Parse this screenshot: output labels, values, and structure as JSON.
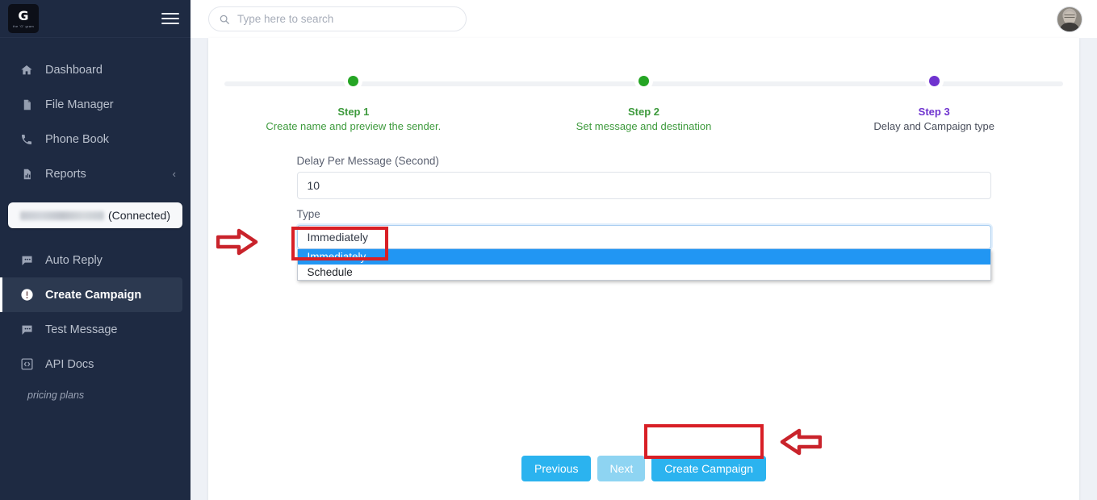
{
  "sidebar": {
    "logo": {
      "letter": "G",
      "subtitle": "the 'G' gram"
    },
    "menu_icon": "hamburger-icon",
    "items": [
      {
        "label": "Dashboard",
        "icon": "home-icon",
        "active": false
      },
      {
        "label": "File Manager",
        "icon": "document-icon",
        "active": false
      },
      {
        "label": "Phone Book",
        "icon": "phone-icon",
        "active": false
      },
      {
        "label": "Reports",
        "icon": "report-chart-icon",
        "active": false,
        "chevron": "‹"
      }
    ],
    "connected_account": {
      "name_redacted": true,
      "status": "(Connected)"
    },
    "items2": [
      {
        "label": "Auto Reply",
        "icon": "chat-bubble-icon",
        "active": false
      },
      {
        "label": "Create Campaign",
        "icon": "alert-circle-icon",
        "active": true
      },
      {
        "label": "Test Message",
        "icon": "chat-bubble-icon",
        "active": false
      },
      {
        "label": "API Docs",
        "icon": "code-brackets-icon",
        "active": false
      }
    ],
    "pricing_link": "pricing plans"
  },
  "topbar": {
    "search": {
      "placeholder": "Type here to search",
      "value": "",
      "icon": "search-icon"
    },
    "avatar": "user-avatar"
  },
  "stepper": {
    "steps": [
      {
        "title": "Step 1",
        "desc": "Create name and preview the sender.",
        "state": "done",
        "color": "#25a524"
      },
      {
        "title": "Step 2",
        "desc": "Set message and destination",
        "state": "done",
        "color": "#25a524"
      },
      {
        "title": "Step 3",
        "desc": "Delay and Campaign type",
        "state": "current",
        "color": "#6f33cf"
      }
    ]
  },
  "form": {
    "delay": {
      "label": "Delay Per Message (Second)",
      "value": "10"
    },
    "type": {
      "label": "Type",
      "selected": "Immediately",
      "options": [
        {
          "label": "Immediately",
          "selected": true
        },
        {
          "label": "Schedule",
          "selected": false
        }
      ]
    }
  },
  "buttons": {
    "previous": "Previous",
    "next": "Next",
    "create": "Create Campaign"
  },
  "annotations": {
    "arrow_left_pointing_right": "red-arrow-right-icon",
    "arrow_right_pointing_left": "red-arrow-left-icon",
    "highlight_color": "#d81f26"
  }
}
